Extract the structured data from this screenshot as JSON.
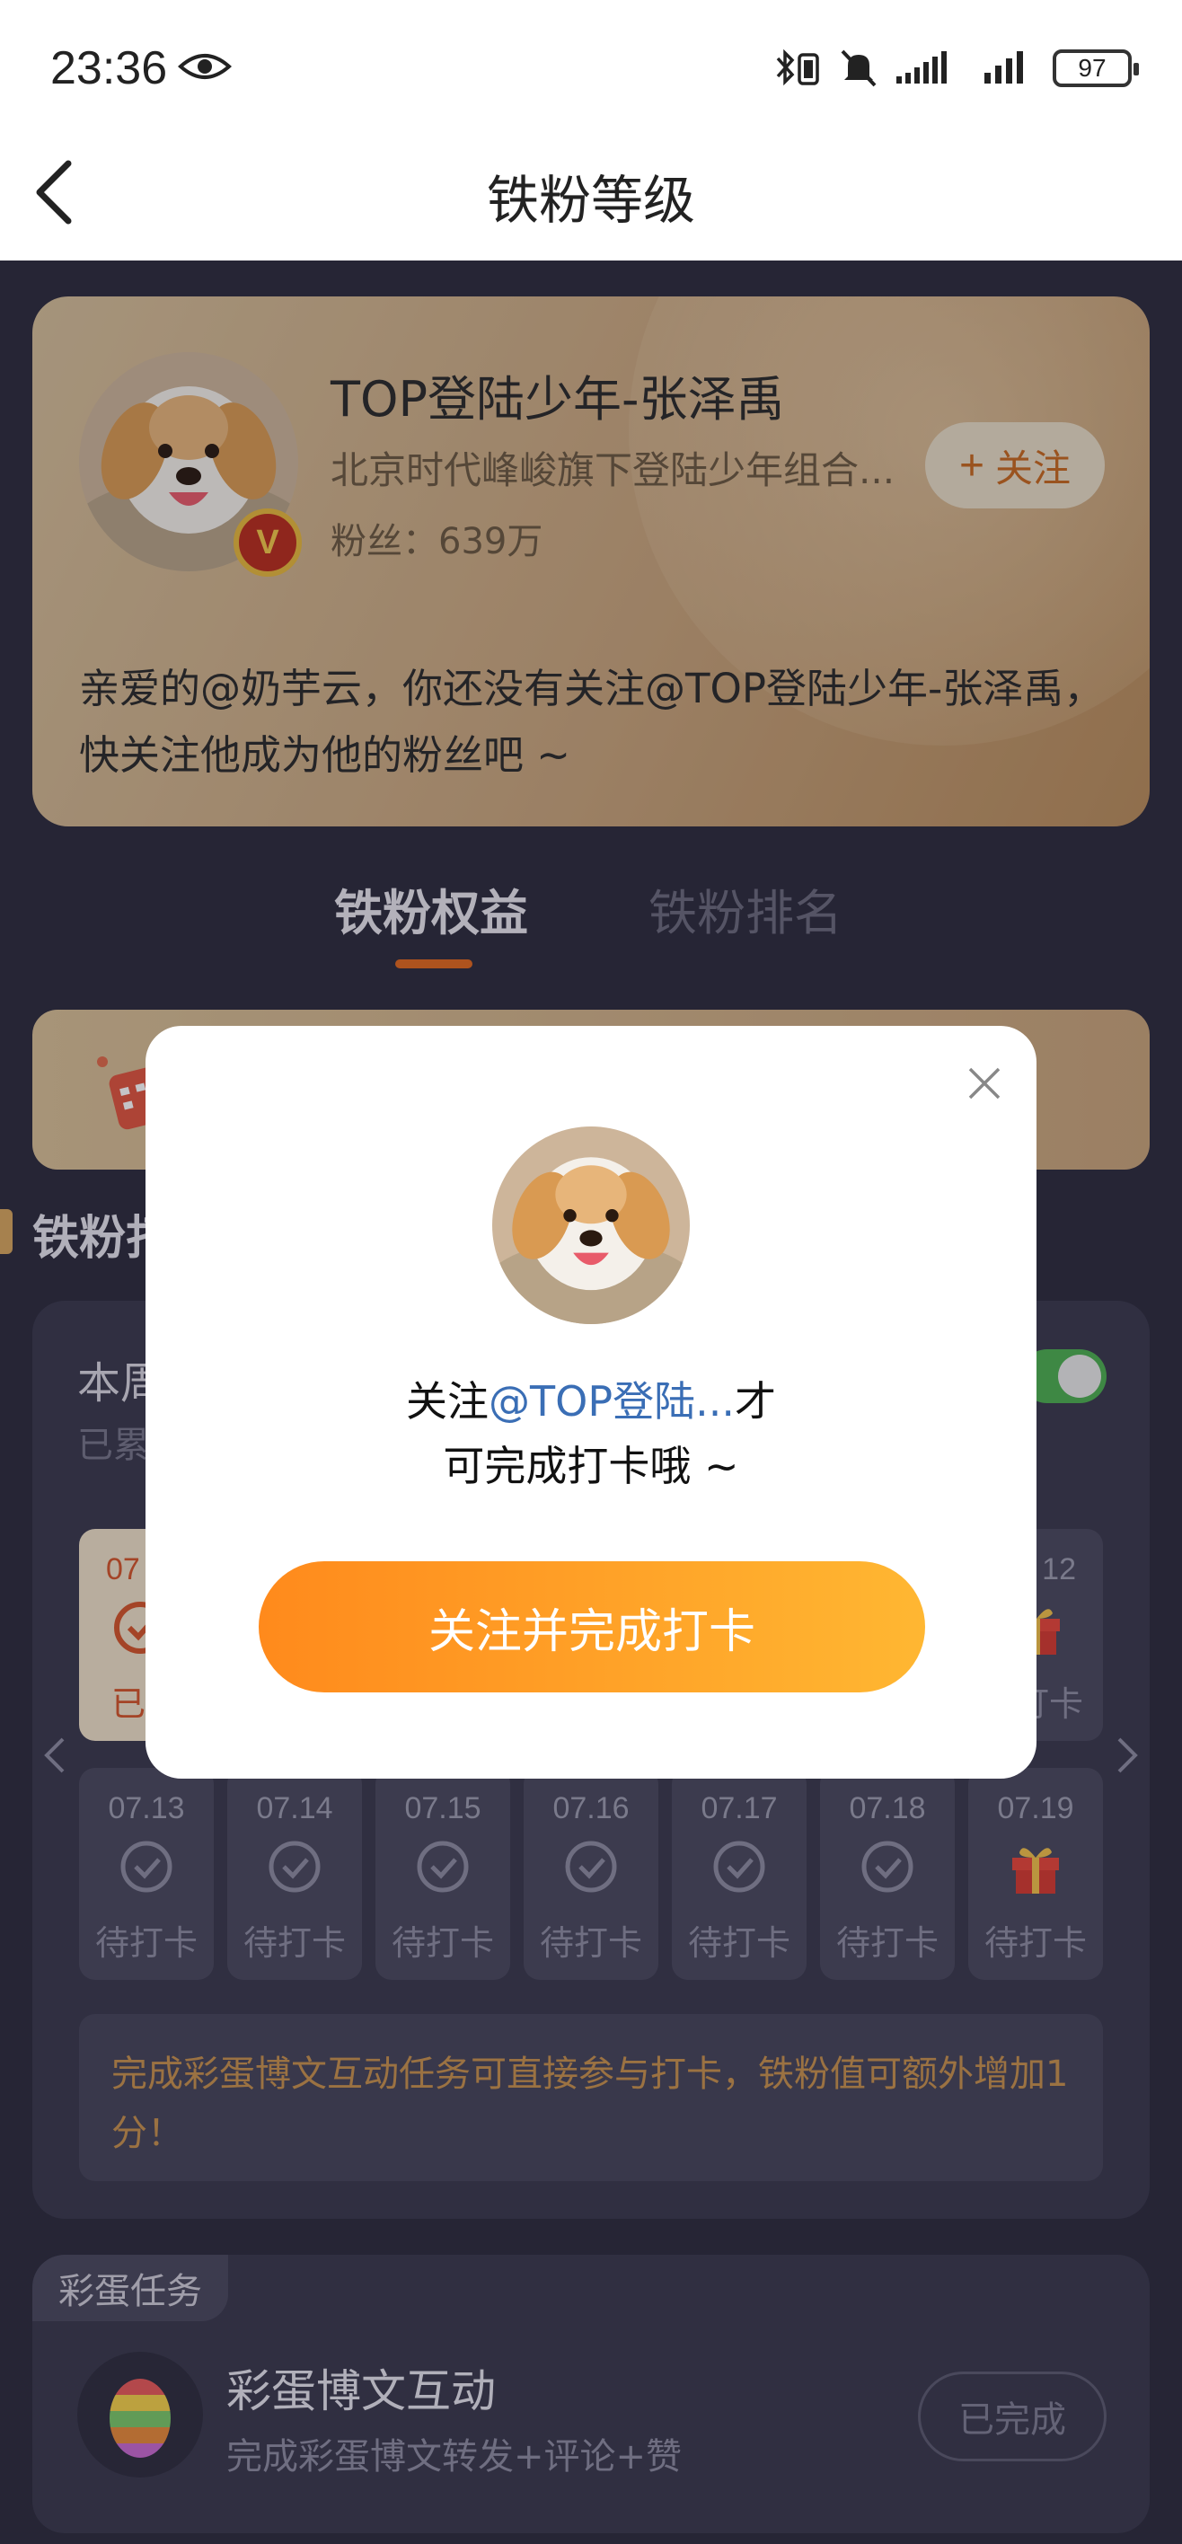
{
  "status_bar": {
    "time": "23:36",
    "battery": "97",
    "icons": [
      "eye-icon",
      "bluetooth-icon",
      "mute-icon",
      "signal-icon",
      "signal-icon"
    ]
  },
  "nav": {
    "title": "铁粉等级",
    "back_icon": "chevron-left-icon"
  },
  "profile": {
    "name": "TOP登陆少年-张泽禹",
    "desc": "北京时代峰峻旗下登陆少年组合...",
    "fans": "粉丝：639万",
    "verified": "V",
    "follow_label": "关注",
    "follow_plus": "+",
    "message": "亲爱的@奶芋云，你还没有关注@TOP登陆少年-张泽禹，快关注他成为他的粉丝吧 ~"
  },
  "tabs": [
    {
      "label": "铁粉权益",
      "active": true
    },
    {
      "label": "铁粉排名",
      "active": false
    }
  ],
  "section": {
    "title": "铁粉打卡"
  },
  "checkin": {
    "week_title": "本周",
    "week_sub": "已累",
    "row1": [
      {
        "date": "07",
        "label": "已",
        "state": "done"
      },
      {
        "date": "12",
        "label": "打卡",
        "state": "gift"
      }
    ],
    "row2": [
      {
        "date": "07.13",
        "label": "待打卡",
        "state": "pending"
      },
      {
        "date": "07.14",
        "label": "待打卡",
        "state": "pending"
      },
      {
        "date": "07.15",
        "label": "待打卡",
        "state": "pending"
      },
      {
        "date": "07.16",
        "label": "待打卡",
        "state": "pending"
      },
      {
        "date": "07.17",
        "label": "待打卡",
        "state": "pending"
      },
      {
        "date": "07.18",
        "label": "待打卡",
        "state": "pending"
      },
      {
        "date": "07.19",
        "label": "待打卡",
        "state": "gift"
      }
    ],
    "tip": "完成彩蛋博文互动任务可直接参与打卡，铁粉值可额外增加1分！"
  },
  "task": {
    "tag": "彩蛋任务",
    "title": "彩蛋博文互动",
    "desc": "完成彩蛋博文转发+评论+赞",
    "button": "已完成"
  },
  "modal": {
    "text_before": "关注",
    "text_link": "@TOP登陆...",
    "text_after": "才",
    "text_line2": "可完成打卡哦 ~",
    "button": "关注并完成打卡"
  },
  "colors": {
    "background": "#2c2b3c",
    "accent_orange": "#ff8a1c",
    "link_blue": "#3a6eb5",
    "gold": "#c9a57c"
  }
}
